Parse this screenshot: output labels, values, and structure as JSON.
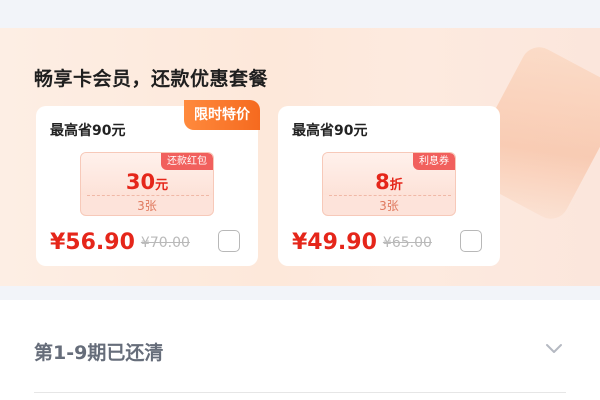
{
  "promo": {
    "title": "畅享卡会员，还款优惠套餐",
    "cards": [
      {
        "save_text": "最高省90元",
        "badge": "限时特价",
        "coupon_tag": "还款红包",
        "coupon_value": "30",
        "coupon_unit": "元",
        "coupon_count": "3张",
        "price": "¥56.90",
        "original_price": "¥70.00",
        "checked": false
      },
      {
        "save_text": "最高省90元",
        "badge": "",
        "coupon_tag": "利息券",
        "coupon_value": "8",
        "coupon_unit": "折",
        "coupon_count": "3张",
        "price": "¥49.90",
        "original_price": "¥65.00",
        "checked": false
      }
    ]
  },
  "period": {
    "label": "第1-9期已还清",
    "icon": "chevron-down-icon"
  },
  "colors": {
    "accent_red": "#e5261a",
    "badge_orange": "#f56a1f",
    "coupon_tag": "#f1605d"
  }
}
